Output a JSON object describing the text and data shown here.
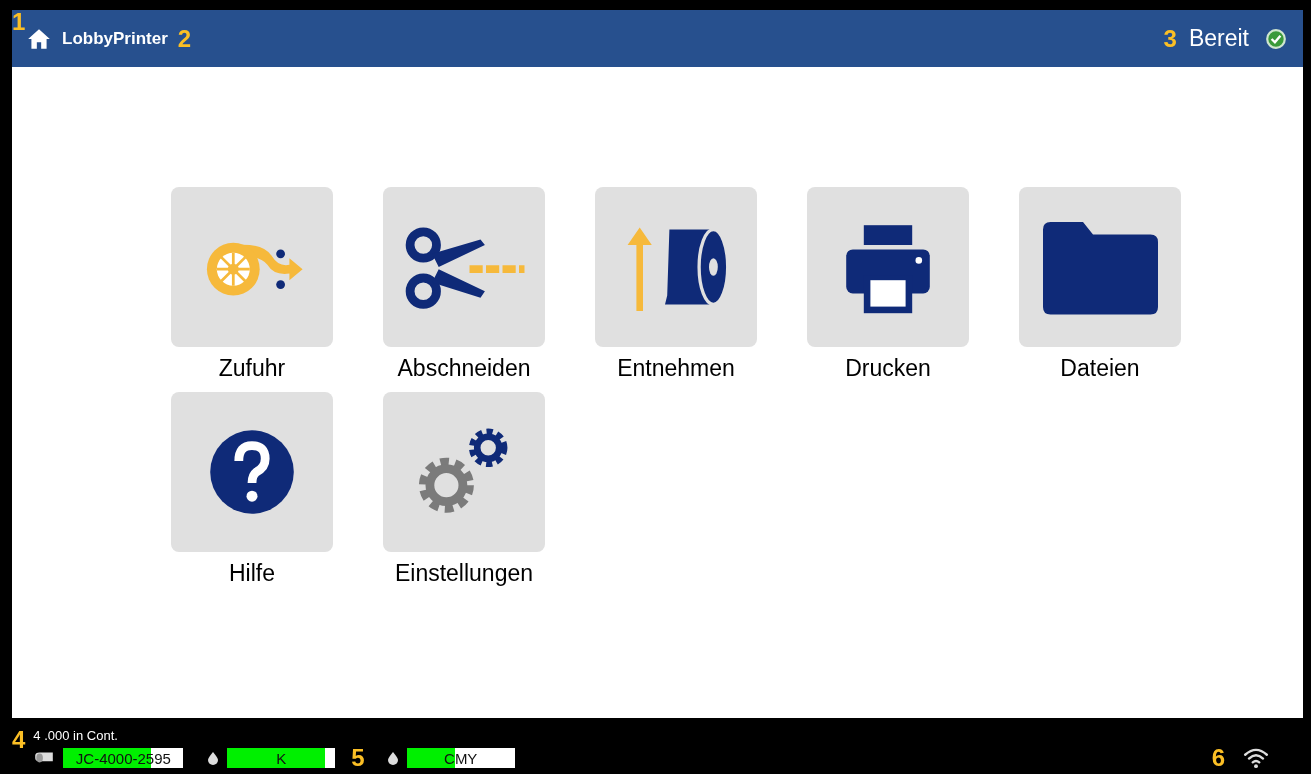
{
  "header": {
    "callout": "1",
    "title": "LobbyPrinter",
    "title_callout": "2",
    "status_callout": "3",
    "status": "Bereit"
  },
  "tiles": [
    {
      "kind": "feed",
      "label": "Zufuhr"
    },
    {
      "kind": "cut",
      "label": "Abschneiden"
    },
    {
      "kind": "eject",
      "label": "Entnehmen"
    },
    {
      "kind": "print",
      "label": "Drucken"
    },
    {
      "kind": "files",
      "label": "Dateien"
    },
    {
      "kind": "help",
      "label": "Hilfe"
    },
    {
      "kind": "settings",
      "label": "Einstellungen"
    }
  ],
  "footer": {
    "callout": "4",
    "media_length": "4 .000 in Cont.",
    "supplies_callout": "5",
    "network_callout": "6",
    "supplies": [
      {
        "kind": "media",
        "label": "JC-4000-2595",
        "level": 0.73
      },
      {
        "kind": "ink",
        "label": "K",
        "level": 0.9
      },
      {
        "kind": "ink",
        "label": "CMY",
        "level": 0.45
      }
    ]
  }
}
